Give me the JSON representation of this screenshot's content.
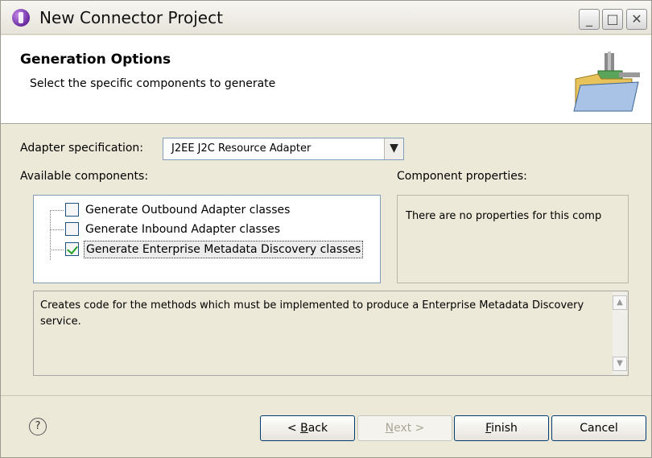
{
  "window": {
    "title": "New Connector Project"
  },
  "header": {
    "title": "Generation Options",
    "description": "Select the specific components to generate"
  },
  "adapter": {
    "label": "Adapter specification:",
    "value": "J2EE J2C Resource Adapter"
  },
  "components": {
    "label": "Available components:",
    "items": [
      {
        "label": "Generate Outbound Adapter classes",
        "checked": false
      },
      {
        "label": "Generate Inbound Adapter classes",
        "checked": false
      },
      {
        "label": "Generate Enterprise Metadata Discovery classes",
        "checked": true,
        "selected": true
      }
    ]
  },
  "properties": {
    "label": "Component properties:",
    "text": "There are no properties for this comp"
  },
  "description": {
    "text": "Creates code for the methods which must be implemented to produce a Enterprise Metadata Discovery service."
  },
  "buttons": {
    "help": "?",
    "back": {
      "prefix": "< ",
      "mnemonic": "B",
      "rest": "ack"
    },
    "next": {
      "mnemonic": "N",
      "rest": "ext >"
    },
    "finish": {
      "mnemonic": "F",
      "rest": "inish"
    },
    "cancel": "Cancel"
  },
  "window_controls": {
    "min": "_",
    "max": "□",
    "close": "✕"
  },
  "dropdown_icon": "chevron-down-icon"
}
